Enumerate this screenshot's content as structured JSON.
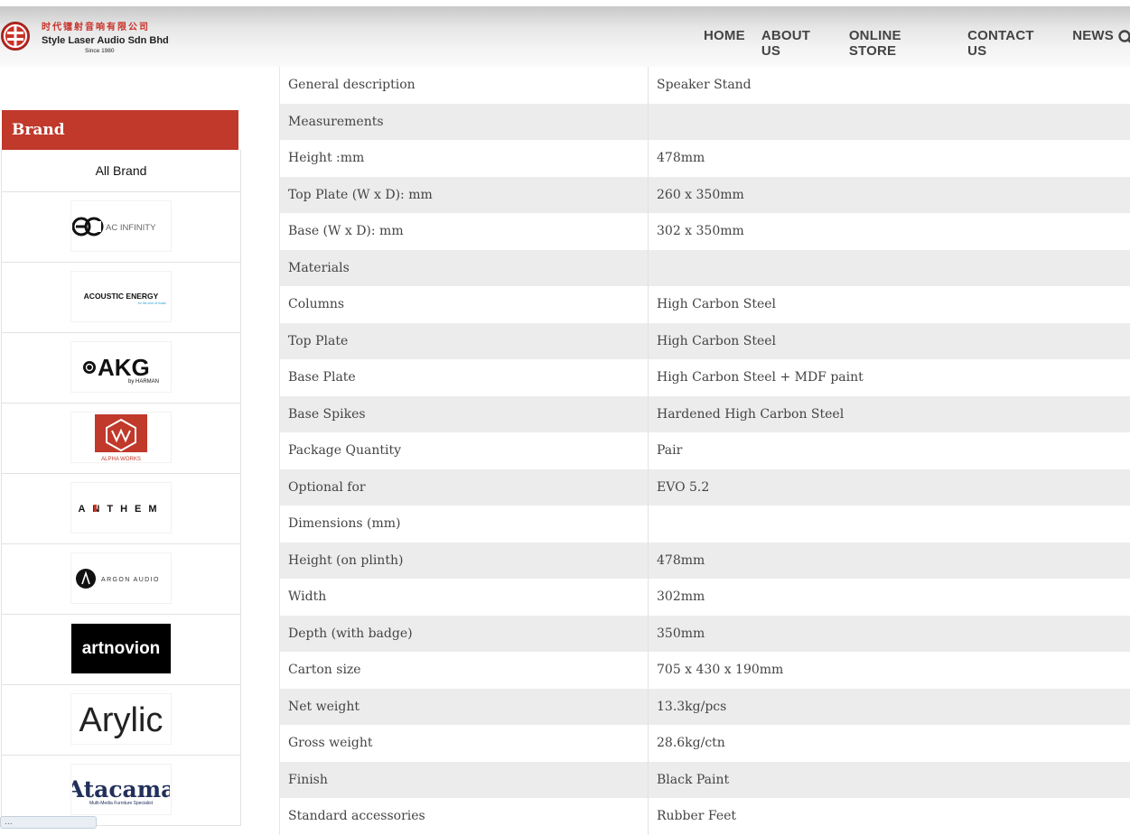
{
  "header": {
    "company_cn": "时代镭射音响有限公司",
    "company_en": "Style Laser Audio Sdn Bhd",
    "since": "Since 1980",
    "nav": [
      "HOME",
      "ABOUT US",
      "ONLINE STORE",
      "CONTACT US",
      "NEWS"
    ],
    "search_icon": "search-icon"
  },
  "sidebar": {
    "heading": "Brand",
    "all_brand": "All Brand",
    "brands": [
      {
        "name": "AC INFINITY",
        "logo_text": "AC INFINITY"
      },
      {
        "name": "ACOUSTIC ENERGY",
        "logo_text": "ACOUSTIC ENERGY",
        "tagline": "for the love of music"
      },
      {
        "name": "AKG",
        "logo_text": "AKG",
        "sub": "by HARMAN"
      },
      {
        "name": "ALPHA WORKS",
        "logo_text": "ALPHA WORKS"
      },
      {
        "name": "ANTHEM",
        "logo_text": "ANTHEM"
      },
      {
        "name": "ARGON AUDIO",
        "logo_text": "ARGON AUDIO"
      },
      {
        "name": "artnovion",
        "logo_text": "artnovion"
      },
      {
        "name": "Arylic",
        "logo_text": "Arylic"
      },
      {
        "name": "Atacama",
        "logo_text": "Atacama",
        "tagline": "Multi-Media Furniture Specialist"
      }
    ]
  },
  "status_bar": "...",
  "spec_table": [
    {
      "label": "General description",
      "value": "Speaker Stand"
    },
    {
      "label": "Measurements",
      "value": ""
    },
    {
      "label": "Height :mm",
      "value": "478mm"
    },
    {
      "label": "Top Plate (W x D): mm",
      "value": "260 x 350mm"
    },
    {
      "label": "Base (W x D): mm",
      "value": "302 x 350mm"
    },
    {
      "label": "Materials",
      "value": ""
    },
    {
      "label": "Columns",
      "value": "High Carbon Steel"
    },
    {
      "label": "Top Plate",
      "value": "High Carbon Steel"
    },
    {
      "label": "Base Plate",
      "value": "High Carbon Steel + MDF paint"
    },
    {
      "label": "Base Spikes",
      "value": "Hardened High Carbon Steel"
    },
    {
      "label": "Package Quantity",
      "value": "Pair"
    },
    {
      "label": "Optional for",
      "value": "EVO 5.2"
    },
    {
      "label": "Dimensions (mm)",
      "value": ""
    },
    {
      "label": "Height (on plinth)",
      "value": "478mm"
    },
    {
      "label": "Width",
      "value": "302mm"
    },
    {
      "label": "Depth (with badge)",
      "value": "350mm"
    },
    {
      "label": "Carton size",
      "value": "705 x 430 x 190mm"
    },
    {
      "label": "Net weight",
      "value": "13.3kg/pcs"
    },
    {
      "label": "Gross weight",
      "value": "28.6kg/ctn"
    },
    {
      "label": "Finish",
      "value": "Black Paint"
    },
    {
      "label": "Standard accessories",
      "value": "Rubber Feet"
    }
  ],
  "colors": {
    "accent": "#c0392b",
    "row_alt": "#ececec"
  }
}
